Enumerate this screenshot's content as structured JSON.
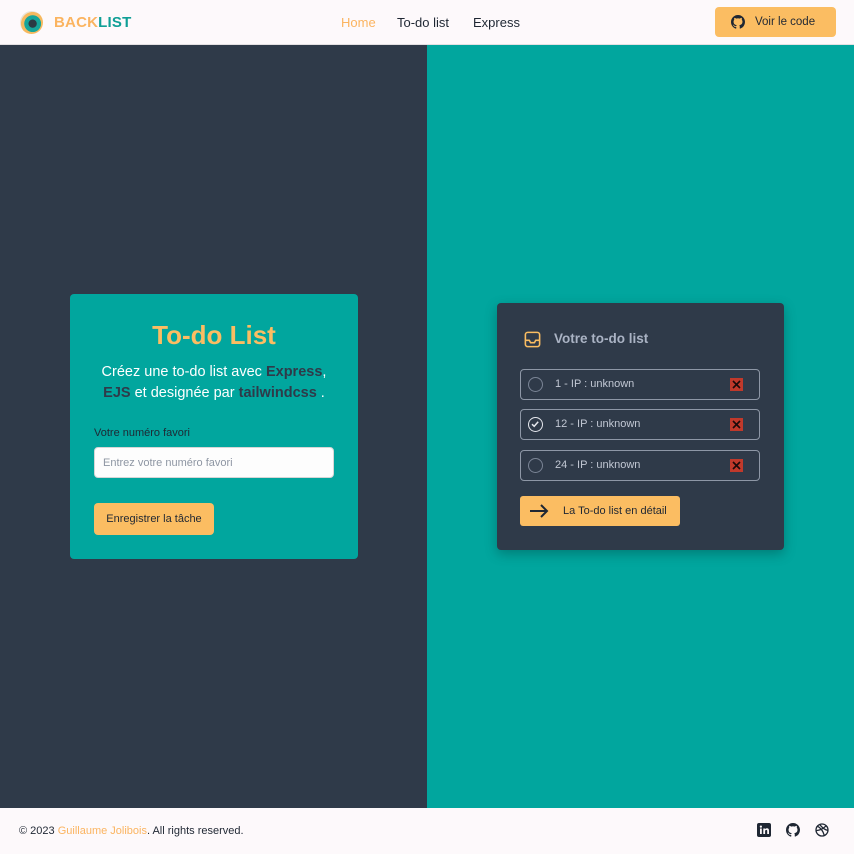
{
  "header": {
    "brand_part1": "BACK",
    "brand_part2": "LIST",
    "nav": {
      "home": "Home",
      "todo": "To-do list",
      "express": "Express"
    },
    "code_button": "Voir le code",
    "code_button_icon": "github-icon"
  },
  "form_card": {
    "title": "To-do List",
    "desc_prefix": "Créez une to-do list avec ",
    "desc_express": "Express",
    "desc_comma": ",",
    "desc_ejs": "EJS",
    "desc_middle": " et designée par ",
    "desc_tailwind": "tailwindcss",
    "desc_end": " .",
    "field_label": "Votre numéro favori",
    "field_placeholder": "Entrez votre numéro favori",
    "submit_label": "Enregistrer la tâche"
  },
  "todo_card": {
    "title": "Votre to-do list",
    "title_icon": "inbox-icon",
    "items": [
      {
        "label": "1 - IP : unknown",
        "checked": false
      },
      {
        "label": "12 - IP : unknown",
        "checked": true
      },
      {
        "label": "24 - IP : unknown",
        "checked": false
      }
    ],
    "detail_button": "La To-do list en détail",
    "detail_button_icon": "arrow-right-icon"
  },
  "footer": {
    "copyright_prefix": "© 2023 ",
    "author": "Guillaume Jolibois",
    "copyright_suffix": ". All rights reserved.",
    "social_icons": [
      "linkedin-icon",
      "github-icon",
      "dribbble-icon"
    ]
  },
  "colors": {
    "accent": "#fbbd62",
    "teal": "#01a69e",
    "dark": "#2f3a49",
    "delete": "#c0392b"
  }
}
